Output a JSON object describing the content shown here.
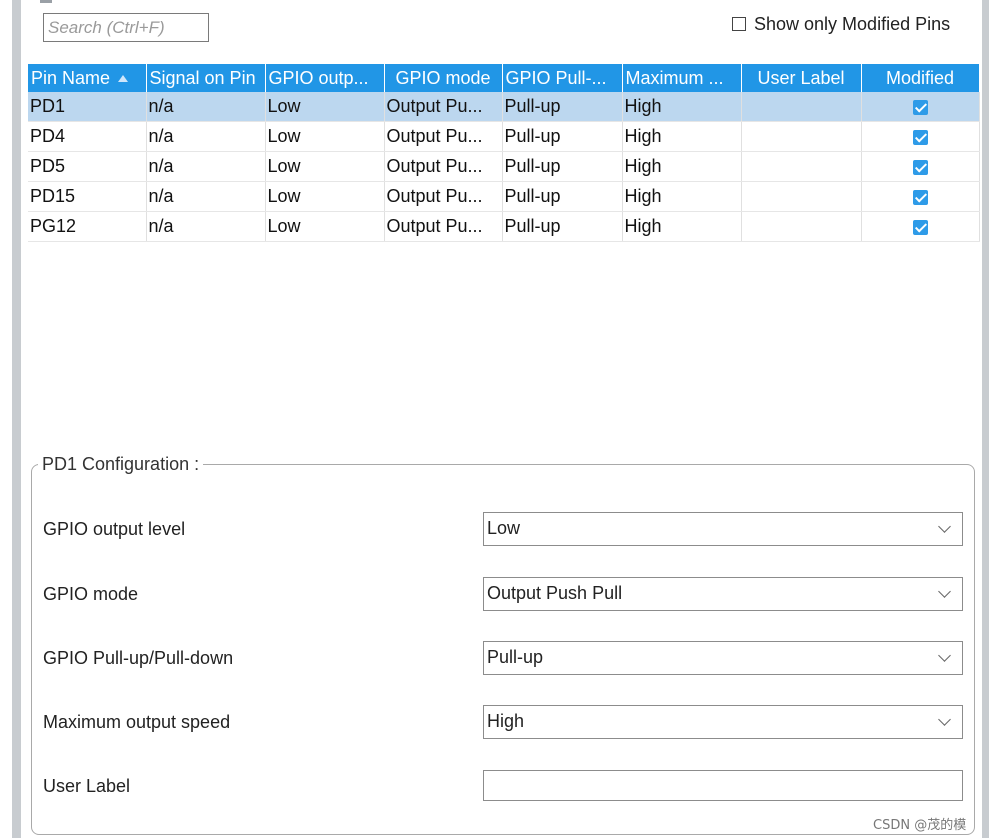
{
  "search": {
    "placeholder": "Search (Ctrl+F)"
  },
  "show_only_modified": {
    "label": "Show only Modified Pins",
    "checked": false
  },
  "table": {
    "headers": [
      "Pin Name",
      "Signal on Pin",
      "GPIO outp...",
      "GPIO mode",
      "GPIO Pull-...",
      "Maximum ...",
      "User Label",
      "Modified"
    ],
    "rows": [
      {
        "pin": "PD1",
        "signal": "n/a",
        "level": "Low",
        "mode": "Output Pu...",
        "pull": "Pull-up",
        "speed": "High",
        "label": "",
        "modified": true,
        "selected": true
      },
      {
        "pin": "PD4",
        "signal": "n/a",
        "level": "Low",
        "mode": "Output Pu...",
        "pull": "Pull-up",
        "speed": "High",
        "label": "",
        "modified": true,
        "selected": false
      },
      {
        "pin": "PD5",
        "signal": "n/a",
        "level": "Low",
        "mode": "Output Pu...",
        "pull": "Pull-up",
        "speed": "High",
        "label": "",
        "modified": true,
        "selected": false
      },
      {
        "pin": "PD15",
        "signal": "n/a",
        "level": "Low",
        "mode": "Output Pu...",
        "pull": "Pull-up",
        "speed": "High",
        "label": "",
        "modified": true,
        "selected": false
      },
      {
        "pin": "PG12",
        "signal": "n/a",
        "level": "Low",
        "mode": "Output Pu...",
        "pull": "Pull-up",
        "speed": "High",
        "label": "",
        "modified": true,
        "selected": false
      }
    ]
  },
  "config": {
    "title": "PD1 Configuration :",
    "output_level": {
      "label": "GPIO output level",
      "value": "Low"
    },
    "mode": {
      "label": "GPIO mode",
      "value": "Output Push Pull"
    },
    "pull": {
      "label": "GPIO Pull-up/Pull-down",
      "value": "Pull-up"
    },
    "speed": {
      "label": "Maximum output speed",
      "value": "High"
    },
    "user_label": {
      "label": "User Label",
      "value": ""
    }
  },
  "watermark": "CSDN @茂的模",
  "colors": {
    "header": "#2196e6",
    "selected_row": "#bcd7ef",
    "checkbox": "#2e9be8"
  }
}
